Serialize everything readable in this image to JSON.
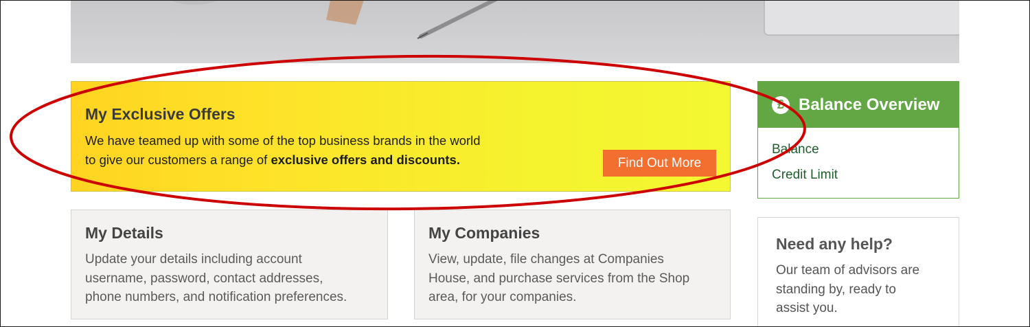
{
  "offers": {
    "title": "My Exclusive Offers",
    "text_line1": "We have teamed up with some of the top business brands in the world",
    "text_line2_prefix": "to give our customers a range of ",
    "text_line2_bold": "exclusive offers and discounts.",
    "button_label": "Find Out More"
  },
  "balance": {
    "icon_symbol": "£",
    "title": "Balance Overview",
    "links": [
      "Balance",
      "Credit Limit"
    ]
  },
  "details": {
    "title": "My Details",
    "lines": [
      "Update your details including account",
      "username, password, contact addresses,",
      "phone numbers, and notification preferences."
    ]
  },
  "companies": {
    "title": "My Companies",
    "lines": [
      "View, update, file changes at Companies",
      "House, and purchase services from the Shop",
      "area, for your companies."
    ]
  },
  "help": {
    "title": "Need any help?",
    "lines": [
      "Our team of advisors are",
      "standing by, ready to",
      "assist you."
    ]
  },
  "colors": {
    "accent_green": "#62a744",
    "button_orange": "#f36f2f",
    "annotation_red": "#cc0000",
    "offer_yellow": "#ffd421"
  },
  "icons": [
    "pound-icon"
  ]
}
